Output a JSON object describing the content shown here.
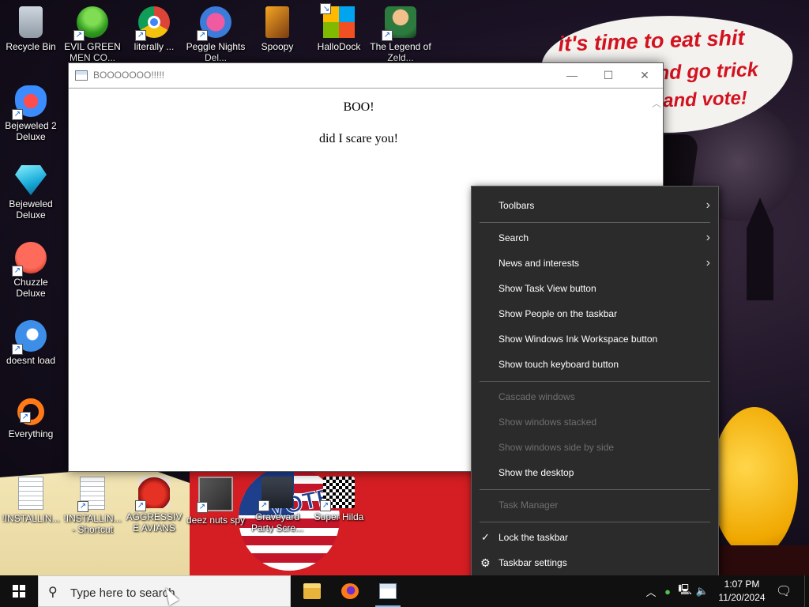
{
  "wallpaper": {
    "speech_line1": "it's time to eat shit",
    "speech_line2": "nd go trick",
    "speech_line3": "and vote!",
    "vote_text": "VOTE"
  },
  "desktop_icons": [
    {
      "label": "Recycle Bin",
      "icon": "recycle-bin-icon"
    },
    {
      "label": "EVIL GREEN MEN CO...",
      "icon": "green-men-icon"
    },
    {
      "label": "literally ...",
      "icon": "chrome-icon"
    },
    {
      "label": "Peggle Nights Del...",
      "icon": "peggle-icon"
    },
    {
      "label": "Spoopy",
      "icon": "spoopy-icon"
    },
    {
      "label": "HalloDock",
      "icon": "windows-logo-icon"
    },
    {
      "label": "The Legend of Zeld...",
      "icon": "zelda-icon"
    },
    {
      "label": "Bejeweled 2 Deluxe",
      "icon": "bejeweled-2-icon"
    },
    {
      "label": "Bejeweled Deluxe",
      "icon": "bejeweled-icon"
    },
    {
      "label": "Chuzzle Deluxe",
      "icon": "chuzzle-icon"
    },
    {
      "label": "doesnt load",
      "icon": "thunderbird-icon"
    },
    {
      "label": "Everything",
      "icon": "everything-icon"
    },
    {
      "label": "!INSTALLIN...",
      "icon": "document-icon"
    },
    {
      "label": "!INSTALLIN... - Shortcut",
      "icon": "document-shortcut-icon"
    },
    {
      "label": "AGGRESSIVE AVIANS",
      "icon": "angry-bird-icon"
    },
    {
      "label": "deez nuts spy",
      "icon": "deez-nuts-icon"
    },
    {
      "label": "Graveyard Party Scre...",
      "icon": "graveyard-icon"
    },
    {
      "label": "Super Hilda",
      "icon": "super-hilda-icon"
    }
  ],
  "window": {
    "title": "BOOOOOOO!!!!!",
    "heading": "BOO!",
    "body": "did I scare you!",
    "minimize": "—",
    "maximize": "☐",
    "close": "✕"
  },
  "context_menu": {
    "items": [
      {
        "label": "Toolbars",
        "submenu": true,
        "enabled": true
      },
      {
        "label": "Search",
        "submenu": true,
        "enabled": true
      },
      {
        "label": "News and interests",
        "submenu": true,
        "enabled": true
      },
      {
        "label": "Show Task View button",
        "enabled": true
      },
      {
        "label": "Show People on the taskbar",
        "enabled": true
      },
      {
        "label": "Show Windows Ink Workspace button",
        "enabled": true
      },
      {
        "label": "Show touch keyboard button",
        "enabled": true
      },
      {
        "label": "Cascade windows",
        "enabled": false
      },
      {
        "label": "Show windows stacked",
        "enabled": false
      },
      {
        "label": "Show windows side by side",
        "enabled": false
      },
      {
        "label": "Show the desktop",
        "enabled": true
      },
      {
        "label": "Task Manager",
        "enabled": false
      },
      {
        "label": "Lock the taskbar",
        "enabled": true,
        "checked": true
      },
      {
        "label": "Taskbar settings",
        "enabled": true,
        "icon": "gear-icon"
      }
    ]
  },
  "taskbar": {
    "search_placeholder": "Type here to search",
    "pinned_apps": [
      "file-explorer-icon",
      "firefox-icon",
      "app-window-icon"
    ],
    "time": "1:07 PM",
    "date": "11/20/2024"
  }
}
